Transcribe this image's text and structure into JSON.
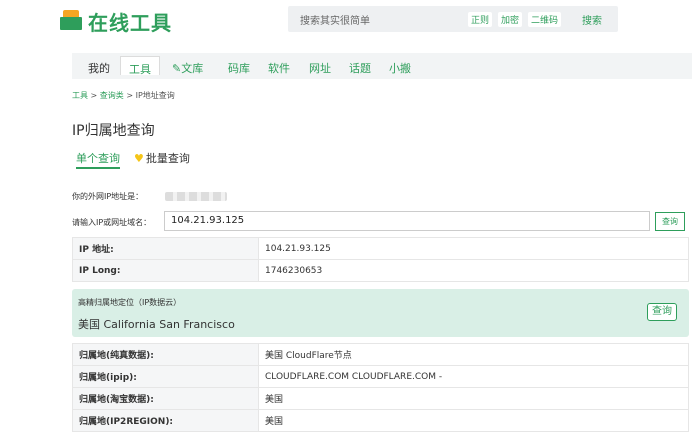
{
  "header": {
    "logo_text": "在线工具",
    "search_placeholder": "搜索其实很简单",
    "chips": [
      "正则",
      "加密",
      "二维码"
    ],
    "search_button": "搜索"
  },
  "nav": {
    "items": [
      "我的",
      "工具",
      "文库",
      "码库",
      "软件",
      "网址",
      "话题",
      "小搬"
    ],
    "active": "工具"
  },
  "breadcrumb": {
    "home": "工具",
    "category": "查询类",
    "current": "IP地址查询",
    "sep": ">"
  },
  "page_title": "IP归属地查询",
  "tabs": {
    "single": "单个查询",
    "batch": "批量查询"
  },
  "my_ip_label": "你的外网IP地址是：",
  "input": {
    "label": "请输入IP或网址域名：",
    "value": "104.21.93.125",
    "button": "查询"
  },
  "basic_rows": [
    {
      "key": "IP 地址:",
      "value": "104.21.93.125"
    },
    {
      "key": "IP Long:",
      "value": "1746230653"
    }
  ],
  "precise": {
    "label": "高精归属地定位（IP数据云）",
    "value": "美国 California San Francisco",
    "button": "查询"
  },
  "location_rows": [
    {
      "key": "归属地(纯真数据):",
      "value": "美国 CloudFlare节点"
    },
    {
      "key": "归属地(ipip):",
      "value": "CLOUDFLARE.COM CLOUDFLARE.COM -"
    },
    {
      "key": "归属地(淘宝数据):",
      "value": "美国"
    },
    {
      "key": "归属地(IP2REGION):",
      "value": "美国"
    }
  ],
  "colors": {
    "brand": "#2e9e5b",
    "accent": "#f5a623",
    "highlight_bg": "#d9efe6"
  }
}
